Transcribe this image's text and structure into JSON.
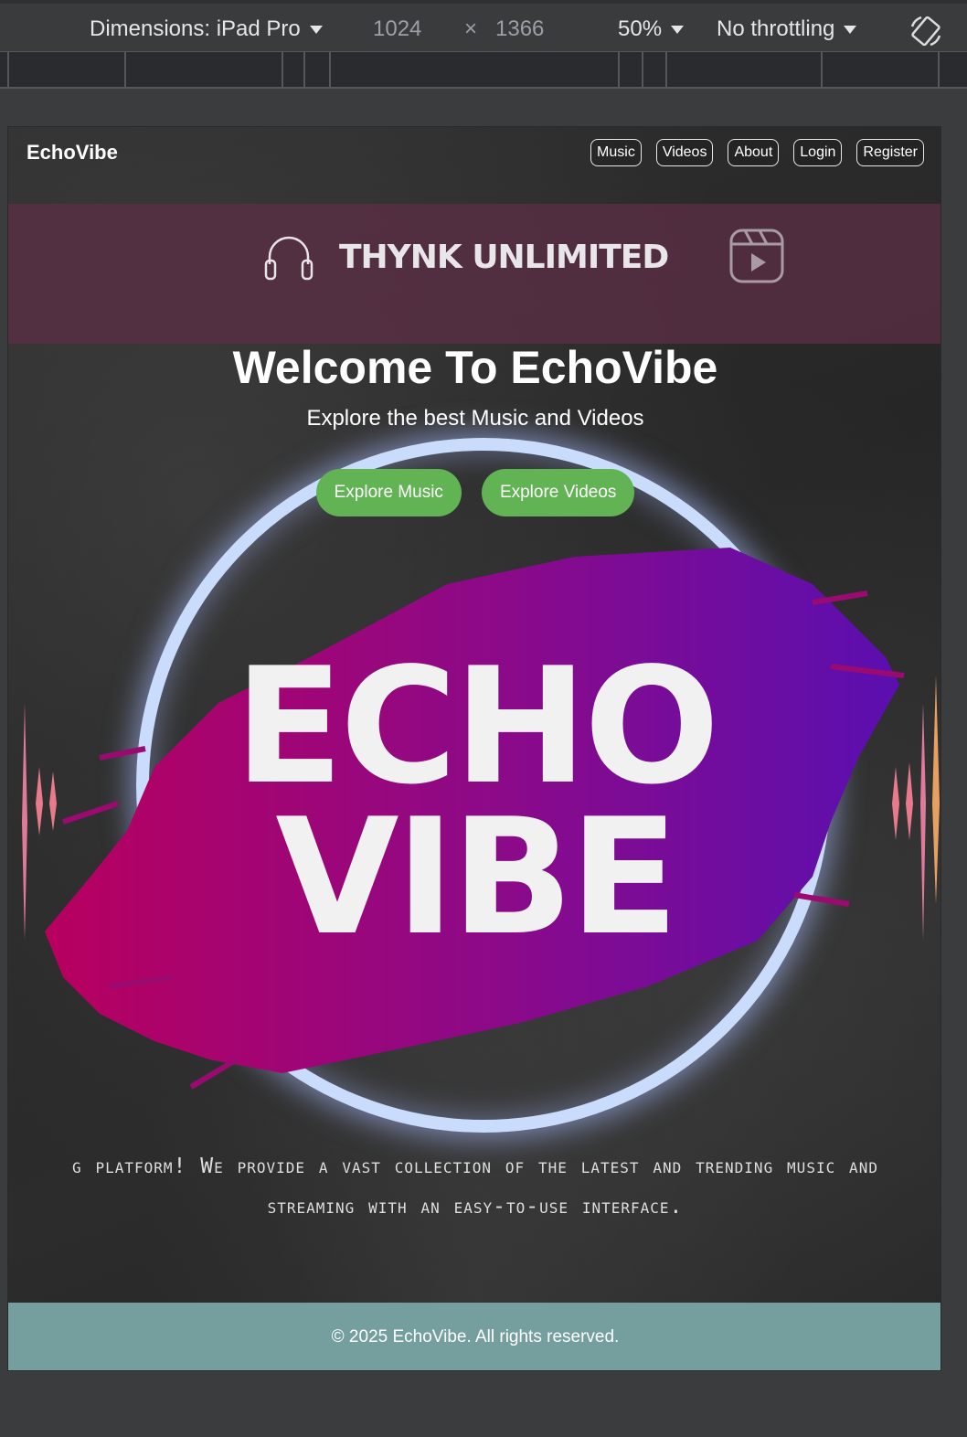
{
  "devtools": {
    "dimensions_label": "Dimensions: iPad Pro",
    "width": "1024",
    "times": "×",
    "height": "1366",
    "zoom": "50%",
    "throttling": "No throttling"
  },
  "site": {
    "brand": "EchoVibe",
    "nav": [
      "Music",
      "Videos",
      "About",
      "Login",
      "Register"
    ],
    "banner_title": "THYNK UNLIMITED",
    "hero_title": "Welcome To EchoVibe",
    "hero_subtitle": "Explore the best Music and Videos",
    "buttons": {
      "music": "Explore Music",
      "videos": "Explore Videos"
    },
    "logo_line1": "ECHO",
    "logo_line2": "VIBE",
    "about_line1": "g platform! We provide a vast collection of the latest and trending music and",
    "about_line2": "streaming with an easy-to-use interface.",
    "footer": "© 2025 EchoVibe. All rights reserved."
  },
  "colors": {
    "cta": "#62b354",
    "footer": "#759e9e",
    "banner": "#5c2d46",
    "ring": "#c9dcfb",
    "brush_start": "#b8005f",
    "brush_end": "#5a0fb0"
  },
  "icons": [
    "chevron-down-icon",
    "rotate-icon",
    "headphones-icon",
    "video-reel-icon"
  ]
}
